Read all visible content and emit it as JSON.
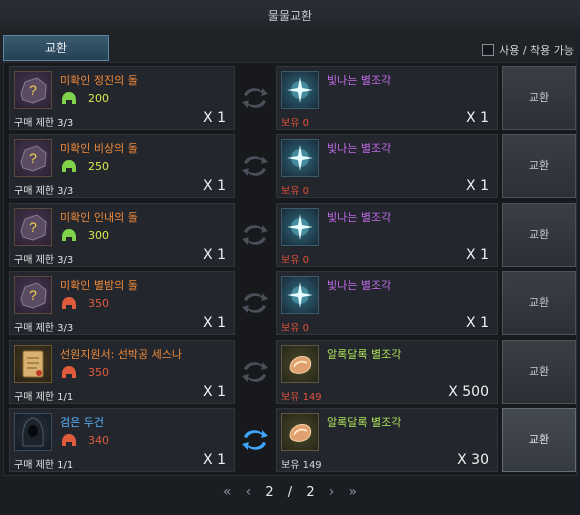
{
  "window": {
    "title": "물물교환"
  },
  "tabs": {
    "exchange": "교환"
  },
  "filter": {
    "label": "사용 / 착용 가능",
    "checked": false
  },
  "exchange_label": "교환",
  "rows": [
    {
      "cost": {
        "name": "미확인 정진의 돌",
        "name_color": "orange",
        "icon": "unidentified-stone-icon",
        "stat_icon": "green-helmet-icon",
        "stat_value": "200",
        "stat_color": "yellow",
        "limit": "구매 제한 3/3",
        "qty": "X 1"
      },
      "reward": {
        "name": "빛나는 별조각",
        "name_color": "purple",
        "icon": "shining-star-fragment-icon",
        "owned": "보유 0",
        "owned_state": "zero",
        "qty": "X 1"
      },
      "button_active": false
    },
    {
      "cost": {
        "name": "미확인 비상의 돌",
        "name_color": "orange",
        "icon": "unidentified-stone-icon",
        "stat_icon": "green-helmet-icon",
        "stat_value": "250",
        "stat_color": "yellow",
        "limit": "구매 제한 3/3",
        "qty": "X 1"
      },
      "reward": {
        "name": "빛나는 별조각",
        "name_color": "purple",
        "icon": "shining-star-fragment-icon",
        "owned": "보유 0",
        "owned_state": "zero",
        "qty": "X 1"
      },
      "button_active": false
    },
    {
      "cost": {
        "name": "미확인 인내의 돌",
        "name_color": "orange",
        "icon": "unidentified-stone-icon",
        "stat_icon": "green-helmet-icon",
        "stat_value": "300",
        "stat_color": "yellow",
        "limit": "구매 제한 3/3",
        "qty": "X 1"
      },
      "reward": {
        "name": "빛나는 별조각",
        "name_color": "purple",
        "icon": "shining-star-fragment-icon",
        "owned": "보유 0",
        "owned_state": "zero",
        "qty": "X 1"
      },
      "button_active": false
    },
    {
      "cost": {
        "name": "미확인 별밤의 돌",
        "name_color": "orange",
        "icon": "unidentified-stone-icon",
        "stat_icon": "red-helmet-icon",
        "stat_value": "350",
        "stat_color": "red",
        "limit": "구매 제한 3/3",
        "qty": "X 1"
      },
      "reward": {
        "name": "빛나는 별조각",
        "name_color": "purple",
        "icon": "shining-star-fragment-icon",
        "owned": "보유 0",
        "owned_state": "zero",
        "qty": "X 1"
      },
      "button_active": false
    },
    {
      "cost": {
        "name": "선원지원서: 선박공 세스나",
        "name_color": "orange",
        "icon": "crew-application-scroll-icon",
        "stat_icon": "red-helmet-icon",
        "stat_value": "350",
        "stat_color": "red",
        "limit": "구매 제한 1/1",
        "qty": "X 1"
      },
      "reward": {
        "name": "알록달록 별조각",
        "name_color": "green",
        "icon": "colorful-star-fragment-icon",
        "owned": "보유 149",
        "owned_state": "zero",
        "qty": "X 500"
      },
      "button_active": false
    },
    {
      "cost": {
        "name": "검은 두건",
        "name_color": "blue",
        "icon": "black-hood-icon",
        "stat_icon": "red-helmet-icon",
        "stat_value": "340",
        "stat_color": "red",
        "limit": "구매 제한 1/1",
        "qty": "X 1"
      },
      "reward": {
        "name": "알록달록 별조각",
        "name_color": "green",
        "icon": "colorful-star-fragment-icon",
        "owned": "보유 149",
        "owned_state": "ok",
        "qty": "X 30"
      },
      "button_active": true
    }
  ],
  "pagination": {
    "current": "2",
    "sep": "/",
    "total": "2"
  }
}
